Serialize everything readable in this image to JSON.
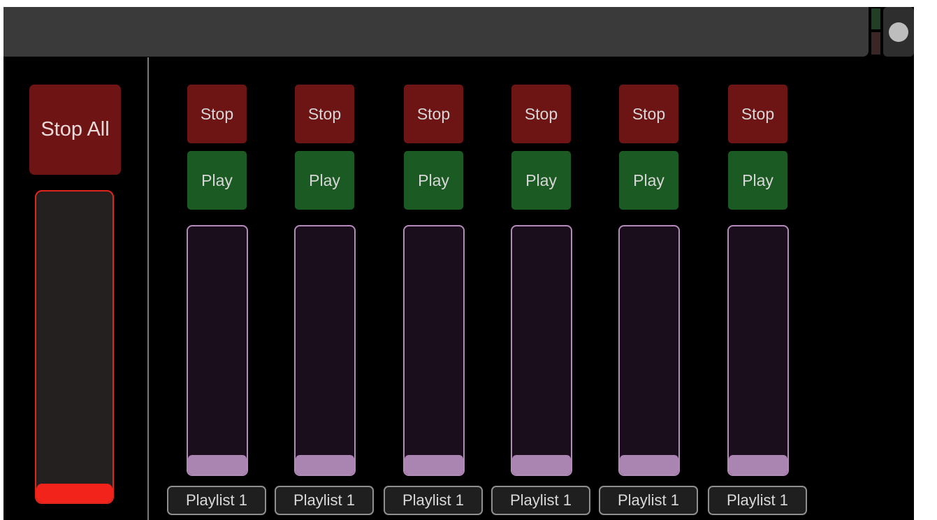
{
  "toolbar": {
    "record_icon": "circle-dot-icon"
  },
  "master": {
    "stop_all_label": "Stop All",
    "level": 0.06,
    "color": "#f1231a"
  },
  "channels": [
    {
      "stop_label": "Stop",
      "play_label": "Play",
      "playlist": "Playlist 1",
      "level": 0.08
    },
    {
      "stop_label": "Stop",
      "play_label": "Play",
      "playlist": "Playlist 1",
      "level": 0.08
    },
    {
      "stop_label": "Stop",
      "play_label": "Play",
      "playlist": "Playlist 1",
      "level": 0.08
    },
    {
      "stop_label": "Stop",
      "play_label": "Play",
      "playlist": "Playlist 1",
      "level": 0.08
    },
    {
      "stop_label": "Stop",
      "play_label": "Play",
      "playlist": "Playlist 1",
      "level": 0.08
    },
    {
      "stop_label": "Stop",
      "play_label": "Play",
      "playlist": "Playlist 1",
      "level": 0.08
    }
  ],
  "colors": {
    "stop": "#6d1515",
    "play": "#1b5a23",
    "fader_accent": "#ab85b1",
    "master_accent": "#e0261c"
  }
}
